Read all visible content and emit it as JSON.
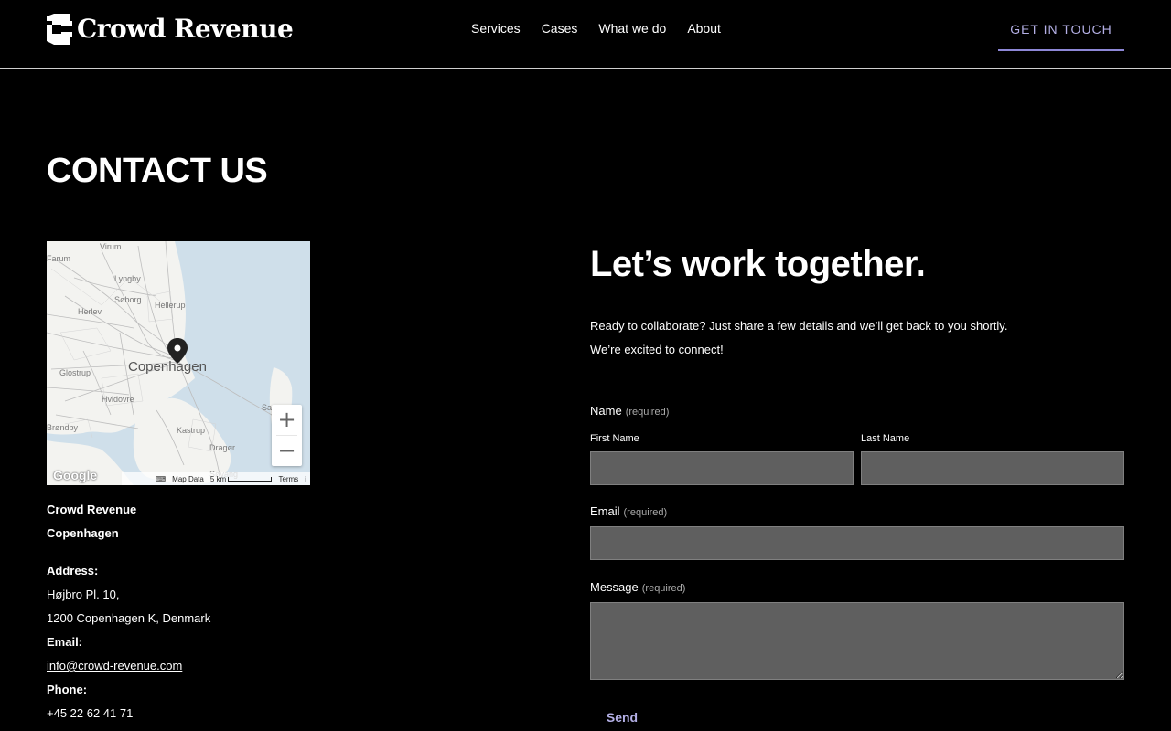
{
  "header": {
    "brand": "Crowd Revenue",
    "nav": [
      "Services",
      "Cases",
      "What we do",
      "About"
    ],
    "cta_label": "GET IN TOUCH",
    "accent_color": "#8d87d6"
  },
  "left": {
    "page_title": "CONTACT US",
    "map": {
      "labels": [
        "Virum",
        "Farum",
        "Lyngby",
        "Søborg",
        "Hellerup",
        "Herlev",
        "Copenhagen",
        "Glostrup",
        "Hvidovre",
        "Kastrup",
        "Dragør",
        "Søvang",
        "Sa",
        "Brøndby"
      ],
      "zoom_in": "+",
      "zoom_out": "−",
      "google": "Google",
      "map_data": "Map Data",
      "scale": "5 km",
      "terms": "Terms",
      "info": "i",
      "keyboard_icon": "keyboard-icon",
      "pin_icon": "map-pin-icon"
    },
    "company": "Crowd Revenue",
    "city": "Copenhagen",
    "address_label": "Address:",
    "address_line1": "Højbro Pl. 10,",
    "address_line2": "1200 Copenhagen K, Denmark",
    "email_label": "Email:",
    "email": "info@crowd-revenue.com",
    "phone_label": "Phone:",
    "phone": "+45 22 62 41 71"
  },
  "form": {
    "headline": "Let’s work together.",
    "intro_line1": "Ready to collaborate? Just share a few details and we’ll get back to you shortly.",
    "intro_line2": "We’re excited to connect!",
    "name_label": "Name",
    "required_text": "(required)",
    "first_name_label": "First Name",
    "last_name_label": "Last Name",
    "email_label": "Email",
    "message_label": "Message",
    "first_name_value": "",
    "last_name_value": "",
    "email_value": "",
    "message_value": "",
    "send_label": "Send"
  }
}
